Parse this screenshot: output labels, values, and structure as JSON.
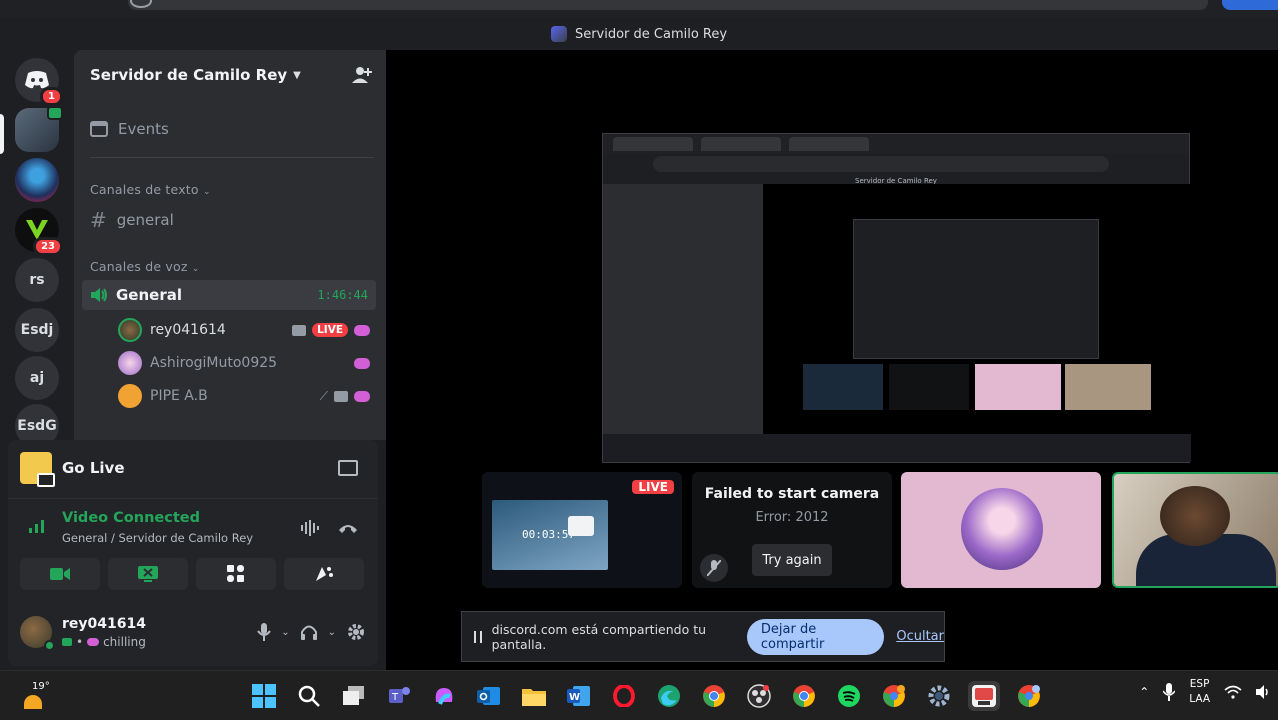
{
  "window": {
    "title": "Servidor de Camilo Rey"
  },
  "rail": {
    "dm_badge": "1",
    "server_badge": "23",
    "text_servers": [
      "rs",
      "Esdj",
      "aj",
      "EsdG"
    ]
  },
  "sidebar": {
    "server_name": "Servidor de Camilo Rey",
    "events_label": "Events",
    "text_category": "Canales de texto",
    "text_channels": [
      "general"
    ],
    "voice_category": "Canales de voz",
    "voice_channel": {
      "name": "General",
      "elapsed": "1:46:44"
    },
    "voice_users": [
      {
        "name": "rey041614",
        "live": "LIVE"
      },
      {
        "name": "AshirogiMuto0925"
      },
      {
        "name": "PIPE A.B"
      }
    ]
  },
  "panel": {
    "golive_label": "Go Live",
    "video_connected": "Video Connected",
    "channel_path": "General / Servidor de Camilo Rey",
    "user": {
      "name": "rey041614",
      "status": "chilling"
    }
  },
  "stage": {
    "tile_live": "LIVE",
    "tile_clock": "00:03:57",
    "camera_error_title": "Failed to start camera",
    "camera_error_code": "Error: 2012",
    "try_again": "Try again",
    "nested_title": "Servidor de Camilo Rey"
  },
  "share_bar": {
    "message": "discord.com está compartiendo tu pantalla.",
    "stop_label": "Dejar de compartir",
    "hide_label": "Ocultar"
  },
  "taskbar": {
    "temperature": "19°",
    "lang_top": "ESP",
    "lang_bottom": "LAA"
  },
  "colors": {
    "accent_green": "#23a55a",
    "live_red": "#f23f43",
    "share_blue": "#a8c7fa"
  }
}
